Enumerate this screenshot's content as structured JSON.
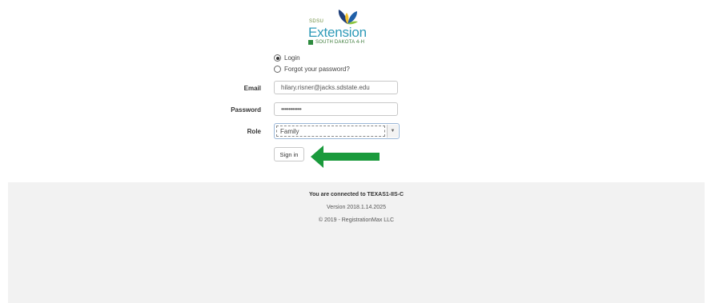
{
  "logo": {
    "small": "SDSU",
    "name": "Extension",
    "sub": "SOUTH DAKOTA 4-H"
  },
  "options": {
    "login": "Login",
    "forgot": "Forgot your password?"
  },
  "form": {
    "email_label": "Email",
    "email_value": "hilary.risner@jacks.sdstate.edu",
    "password_label": "Password",
    "password_value": "•••••••••••",
    "role_label": "Role",
    "role_value": "Family",
    "submit_label": "Sign in"
  },
  "footer": {
    "connected": "You are connected to TEXAS1-IIS-C",
    "version": "Version 2018.1.14.2025",
    "copyright": "© 2019 - RegistrationMax LLC"
  },
  "colors": {
    "arrow": "#1a9a3c",
    "brand_blue": "#2e9ab8",
    "brand_green": "#3c7b3a",
    "leaf_yellow": "#f2c12e",
    "leaf_navy": "#1f3f7a"
  }
}
